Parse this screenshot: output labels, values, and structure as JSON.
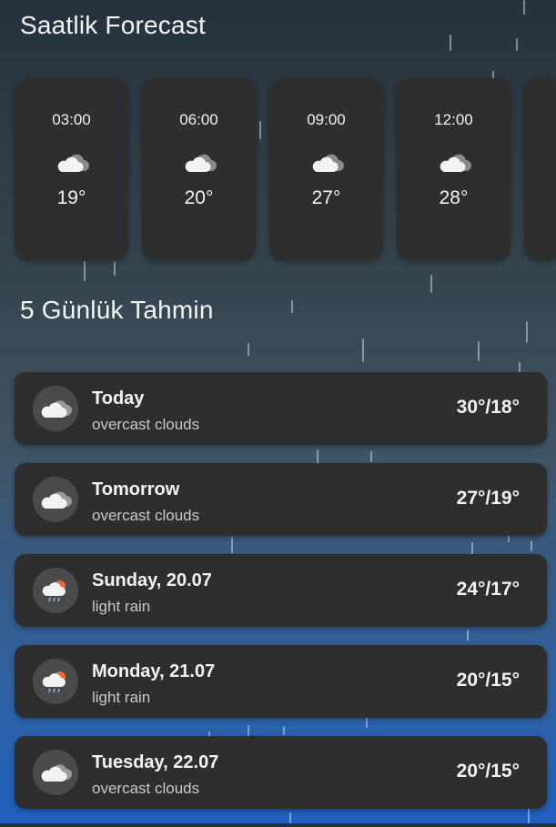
{
  "hourly": {
    "title": "Saatlik Forecast",
    "items": [
      {
        "time": "03:00",
        "icon": "cloud-icon",
        "temp": "19°"
      },
      {
        "time": "06:00",
        "icon": "cloud-icon",
        "temp": "20°"
      },
      {
        "time": "09:00",
        "icon": "cloud-icon",
        "temp": "27°"
      },
      {
        "time": "12:00",
        "icon": "cloud-icon",
        "temp": "28°"
      }
    ]
  },
  "daily": {
    "title": "5 Günlük Tahmin",
    "items": [
      {
        "day": "Today",
        "description": "overcast clouds",
        "temps": "30°/18°",
        "icon": "overcast-cloud-icon"
      },
      {
        "day": "Tomorrow",
        "description": "overcast clouds",
        "temps": "27°/19°",
        "icon": "overcast-cloud-icon"
      },
      {
        "day": "Sunday, 20.07",
        "description": "light rain",
        "temps": "24°/17°",
        "icon": "sun-rain-cloud-icon"
      },
      {
        "day": "Monday, 21.07",
        "description": "light rain",
        "temps": "20°/15°",
        "icon": "sun-rain-cloud-icon"
      },
      {
        "day": "Tuesday, 22.07",
        "description": "overcast clouds",
        "temps": "20°/15°",
        "icon": "overcast-cloud-icon"
      }
    ]
  },
  "colors": {
    "card": "#2e2e2e",
    "icon_circle": "#4a4a4a",
    "background_top": "#26313b",
    "background_bottom": "#1f5fbf",
    "sun": "#f0683a"
  }
}
